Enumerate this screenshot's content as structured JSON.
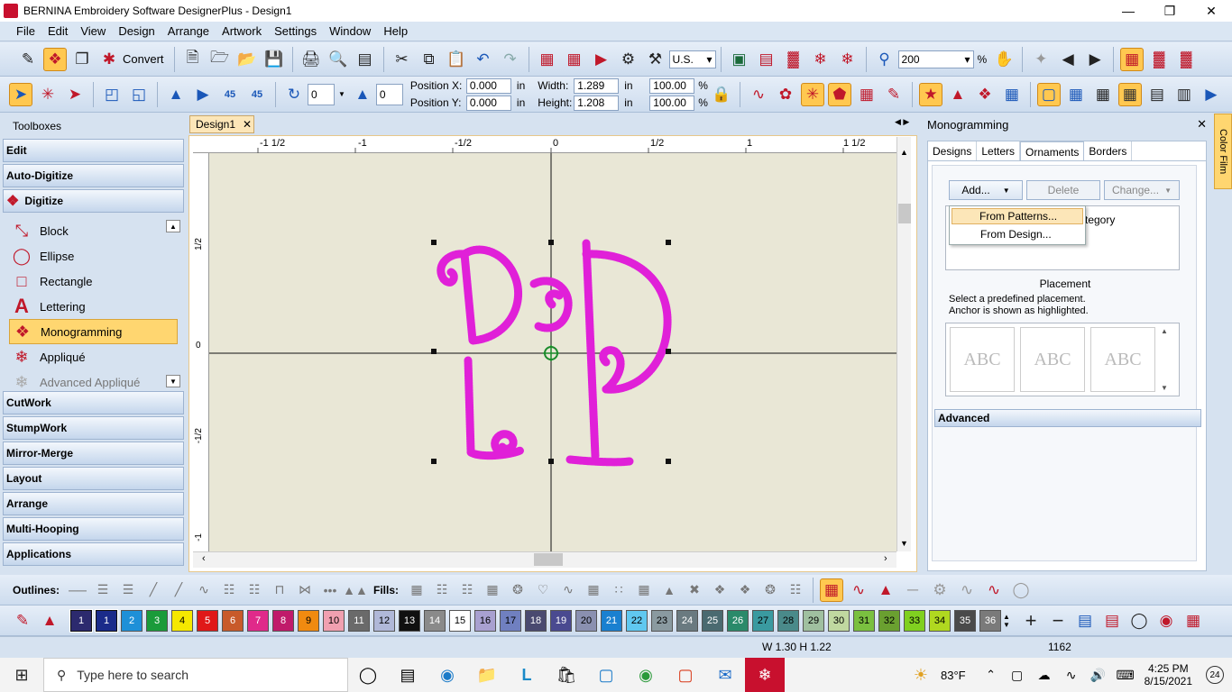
{
  "window": {
    "title": "BERNINA Embroidery Software DesignerPlus - Design1",
    "min_icon": "minimize-icon",
    "max_icon": "restore-icon",
    "close_icon": "close-icon"
  },
  "menu": [
    "File",
    "Edit",
    "View",
    "Design",
    "Arrange",
    "Artwork",
    "Settings",
    "Window",
    "Help"
  ],
  "toolbar1": {
    "convert_label": "Convert",
    "units_value": "U.S.",
    "zoom_value": "200",
    "zoom_unit": "%"
  },
  "toolbar2": {
    "rotate_left_value": "0",
    "slant_value": "0",
    "pos_x_label": "Position X:",
    "pos_x_value": "0.000",
    "pos_y_label": "Position Y:",
    "pos_y_value": "0.000",
    "in1": "in",
    "in2": "in",
    "width_label": "Width:",
    "width_value": "1.289",
    "height_label": "Height:",
    "height_value": "1.208",
    "in3": "in",
    "in4": "in",
    "pct_w": "100.00",
    "pct_h": "100.00",
    "pct1": "%",
    "pct2": "%",
    "rot45a": "45",
    "rot45b": "45"
  },
  "toolboxes": {
    "header": "Toolboxes",
    "sections_top": [
      "Edit",
      "Auto-Digitize"
    ],
    "digitize_label": "Digitize",
    "tools": [
      {
        "label": "Block",
        "icon": "block-icon"
      },
      {
        "label": "Ellipse",
        "icon": "ellipse-icon"
      },
      {
        "label": "Rectangle",
        "icon": "rectangle-icon"
      },
      {
        "label": "Lettering",
        "icon": "lettering-icon"
      },
      {
        "label": "Monogramming",
        "icon": "monogramming-icon"
      },
      {
        "label": "Appliqué",
        "icon": "applique-icon"
      },
      {
        "label": "Advanced Appliqué",
        "icon": "advanced-applique-icon"
      }
    ],
    "sections_bottom": [
      "CutWork",
      "StumpWork",
      "Mirror-Merge",
      "Layout",
      "Arrange",
      "Multi-Hooping",
      "Applications"
    ]
  },
  "document": {
    "tab_label": "Design1",
    "ruler_h": [
      "-1 1/2",
      "-1",
      "-1/2",
      "0",
      "1/2",
      "1",
      "1 1/2"
    ],
    "ruler_v": [
      "1/2",
      "0",
      "-1/2",
      "-1"
    ],
    "design_color": "#e020d8"
  },
  "monogramming": {
    "title": "Monogramming",
    "tabs": [
      "Designs",
      "Letters",
      "Ornaments",
      "Borders"
    ],
    "selected_tab": "Ornaments",
    "add_label": "Add...",
    "delete_label": "Delete",
    "change_label": "Change...",
    "dropdown": [
      "From Patterns...",
      "From Design..."
    ],
    "list_partial": "tegory",
    "placement_title": "Placement",
    "placement_hint1": "Select a predefined placement.",
    "placement_hint2": "Anchor is shown as highlighted.",
    "placement_text": "ABC",
    "advanced_label": "Advanced"
  },
  "side_strip": "Color Film",
  "bottom": {
    "outlines_label": "Outlines:",
    "fills_label": "Fills:",
    "swatches": [
      {
        "n": "1",
        "c": "#2c2a6e"
      },
      {
        "n": "1",
        "c": "#1a2b8a"
      },
      {
        "n": "2",
        "c": "#1e90d8"
      },
      {
        "n": "3",
        "c": "#1a9b3a"
      },
      {
        "n": "4",
        "c": "#f5e800"
      },
      {
        "n": "5",
        "c": "#e01818"
      },
      {
        "n": "6",
        "c": "#c85a2a"
      },
      {
        "n": "7",
        "c": "#e02a8a"
      },
      {
        "n": "8",
        "c": "#c01a6a"
      },
      {
        "n": "9",
        "c": "#f08a10"
      },
      {
        "n": "10",
        "c": "#f0a0b0"
      },
      {
        "n": "11",
        "c": "#6a6a6a"
      },
      {
        "n": "12",
        "c": "#b0b8d8"
      },
      {
        "n": "13",
        "c": "#101010"
      },
      {
        "n": "14",
        "c": "#8a8a8a"
      },
      {
        "n": "15",
        "c": "#ffffff"
      },
      {
        "n": "16",
        "c": "#a8a0d0"
      },
      {
        "n": "17",
        "c": "#7080c0"
      },
      {
        "n": "18",
        "c": "#4a4a70"
      },
      {
        "n": "19",
        "c": "#4a4a90"
      },
      {
        "n": "20",
        "c": "#8a90b0"
      },
      {
        "n": "21",
        "c": "#1a80d0"
      },
      {
        "n": "22",
        "c": "#60c8f0"
      },
      {
        "n": "23",
        "c": "#8a9aa0"
      },
      {
        "n": "24",
        "c": "#6a7a80"
      },
      {
        "n": "25",
        "c": "#4a6a70"
      },
      {
        "n": "26",
        "c": "#2a8a6a"
      },
      {
        "n": "27",
        "c": "#3a9aa0"
      },
      {
        "n": "28",
        "c": "#4a8a8a"
      },
      {
        "n": "29",
        "c": "#a0c0a0"
      },
      {
        "n": "30",
        "c": "#c0d8a0"
      },
      {
        "n": "31",
        "c": "#7ac040"
      },
      {
        "n": "32",
        "c": "#6aa030"
      },
      {
        "n": "33",
        "c": "#80d020"
      },
      {
        "n": "34",
        "c": "#b0d820"
      },
      {
        "n": "35",
        "c": "#4a4a4a"
      },
      {
        "n": "36",
        "c": "#7a7a7a"
      }
    ]
  },
  "status": {
    "dims": "W 1.30 H 1.22",
    "stitches": "1162"
  },
  "taskbar": {
    "search_placeholder": "Type here to search",
    "weather": "83°F",
    "time": "4:25 PM",
    "date": "8/15/2021",
    "notif_count": "24"
  }
}
